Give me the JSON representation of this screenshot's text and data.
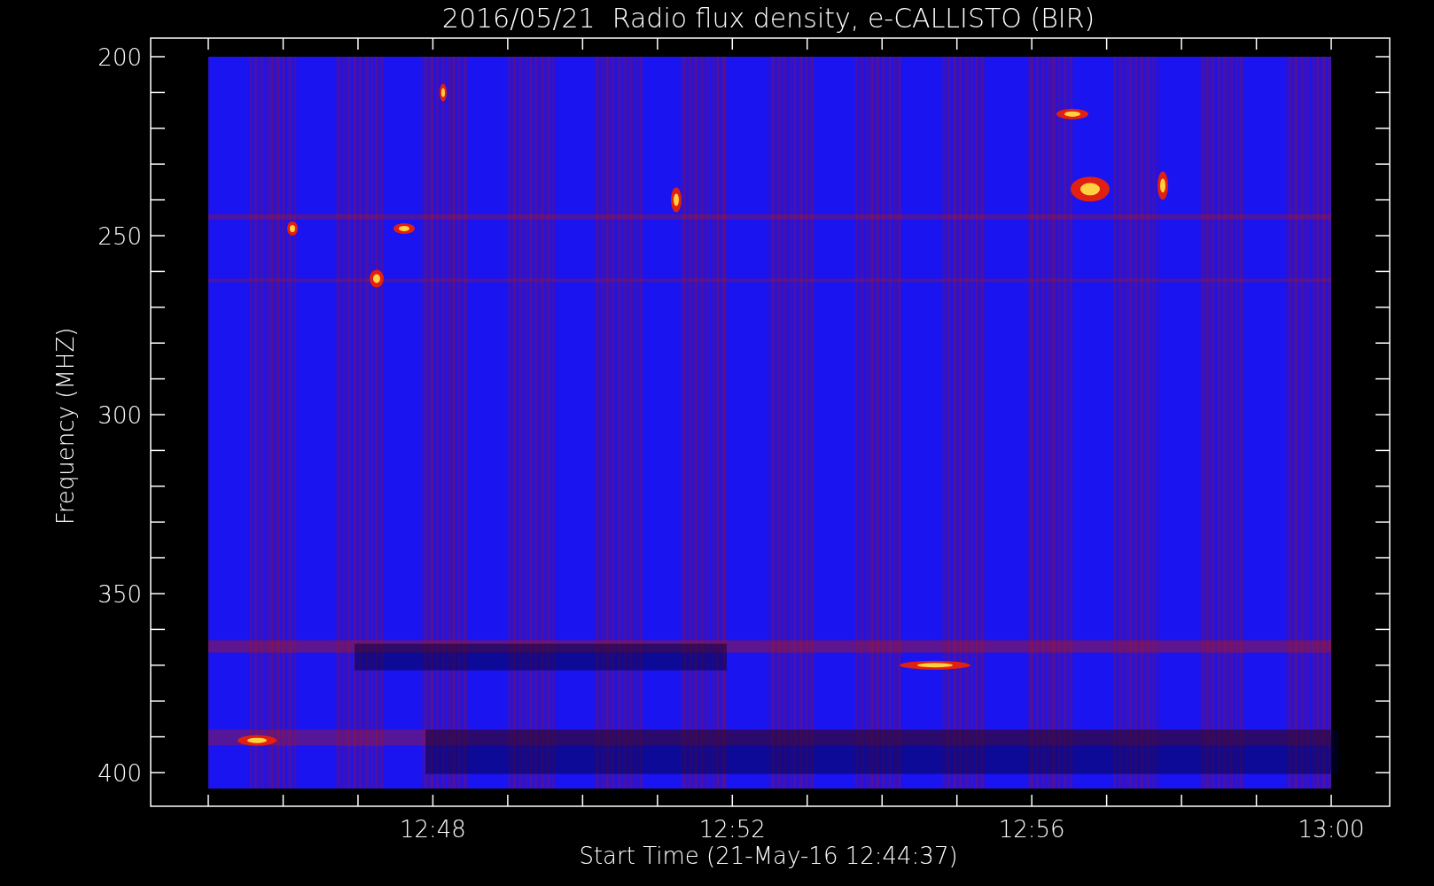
{
  "title": "2016/05/21  Radio flux density, e-CALLISTO (BIR)",
  "y_axis": {
    "label": "Frequency (MHZ)",
    "ticks": [
      "200",
      "250",
      "300",
      "350",
      "400"
    ]
  },
  "x_axis": {
    "label": "Start Time (21-May-16 12:44:37)",
    "ticks": [
      "12:48",
      "12:52",
      "12:56",
      "13:00"
    ]
  }
}
